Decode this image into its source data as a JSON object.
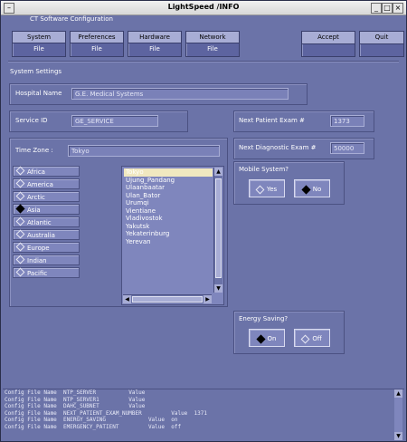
{
  "window": {
    "title": "LightSpeed /INFO"
  },
  "app": {
    "header": "CT Software Configuration"
  },
  "toolbar": {
    "system": {
      "label": "System",
      "sub": "File"
    },
    "preferences": {
      "label": "Preferences",
      "sub": "File"
    },
    "hardware": {
      "label": "Hardware",
      "sub": "File"
    },
    "network": {
      "label": "Network",
      "sub": "File"
    },
    "accept": {
      "label": "Accept"
    },
    "quit": {
      "label": "Quit"
    }
  },
  "system_settings": {
    "title": "System Settings",
    "hospital_name": {
      "label": "Hospital Name",
      "value": "G.E. Medical Systems"
    },
    "service_id": {
      "label": "Service ID",
      "value": "GE_SERVICE"
    },
    "next_patient_exam": {
      "label": "Next Patient Exam #",
      "value": "1373"
    },
    "next_diagnostic_exam": {
      "label": "Next Diagnostic Exam #",
      "value": "50000"
    },
    "time_zone": {
      "label": "Time Zone :",
      "value": "Tokyo",
      "regions": [
        "Africa",
        "America",
        "Arctic",
        "Asia",
        "Atlantic",
        "Australia",
        "Europe",
        "Indian",
        "Pacific"
      ],
      "selected_region": "Asia",
      "cities": [
        "Tokyo",
        "Ujung_Pandang",
        "Ulaanbaatar",
        "Ulan_Bator",
        "Urumqi",
        "Vientiane",
        "Vladivostok",
        "Yakutsk",
        "Yekaterinburg",
        "Yerevan"
      ],
      "selected_city": "Tokyo"
    },
    "mobile_system": {
      "label": "Mobile System?",
      "yes": "Yes",
      "no": "No",
      "selected": "No"
    },
    "energy_saving": {
      "label": "Energy Saving?",
      "on": "On",
      "off": "Off",
      "selected": "On"
    }
  },
  "log": {
    "lines": [
      "Config File Name  NTP_SERVER          Value",
      "Config File Name  NTP_SERVER1         Value",
      "Config File Name  DAHC_SUBNET         Value",
      "Config File Name  NEXT_PATIENT_EXAM_NUMBER         Value  1371",
      "Config File Name  ENERGY_SAVING             Value  on",
      "Config File Name  EMERGENCY_PATIENT         Value  off"
    ]
  },
  "colors": {
    "background": "#6b73a8",
    "field": "#7a81b8",
    "button": "#a8add5",
    "selection": "#f0e8c0"
  }
}
